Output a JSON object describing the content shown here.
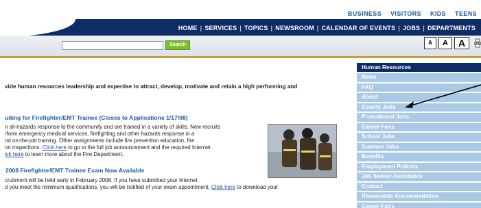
{
  "utility_nav": [
    "BUSINESS",
    "VISITORS",
    "KIDS",
    "TEENS"
  ],
  "main_nav": [
    "HOME",
    "SERVICES",
    "TOPICS",
    "NEWSROOM",
    "CALENDAR OF EVENTS",
    "JOBS",
    "DEPARTMENTS"
  ],
  "search": {
    "button_label": "Search",
    "value": ""
  },
  "text_size": {
    "small": "A",
    "medium": "A",
    "large": "A"
  },
  "content": {
    "mission": "vide human resources leadership and expertise to attract, develop, motivate and retain a high performing and",
    "article1": {
      "title": "uiting for Firefighter/EMT Trainee (Closes to Applications 1/17/08)",
      "line1": "n all-hazards response to the community and are trained in a variety of skills.  New recruits",
      "line2": "rform emergency medical services, firefighting and other hazards response in a",
      "line3": "nd on-the-job training. Other assignments include fire prevention education, fire",
      "line4_before": "on inspections. ",
      "line4_link": "Click here",
      "line4_after": " to go to the full job announcement and the required Internet",
      "line5_link": "ick here",
      "line5_after": " to learn more about the Fire Department."
    },
    "article2": {
      "title": "2008 Firefighter/EMT Trainee Exam Now Available",
      "line1": "cruitment will be held early in February 2008.  If you have submitted your Internet",
      "line2_before": "d you meet the minimum qualifications, you will be notified of your exam appointment.  ",
      "line2_link": "Click here",
      "line2_after": " to download your"
    }
  },
  "sidebar": {
    "header": "Human Resources",
    "items": [
      "News",
      "FAQ",
      "About",
      "County Jobs",
      "Promotional Jobs",
      "Career Fairs",
      "School Jobs",
      "Summer Jobs",
      "Benefits",
      "Employment Policies",
      "Job Seeker Assistance",
      "Contact",
      "Reasonable Accommodation",
      "Career Fairs"
    ]
  },
  "colors": {
    "nav_band": "#0e2c66",
    "sidebar_item": "#a9c9e7",
    "link": "#1f5a99",
    "search_button": "#7dbe2a",
    "accent_line": "#c89b35"
  }
}
